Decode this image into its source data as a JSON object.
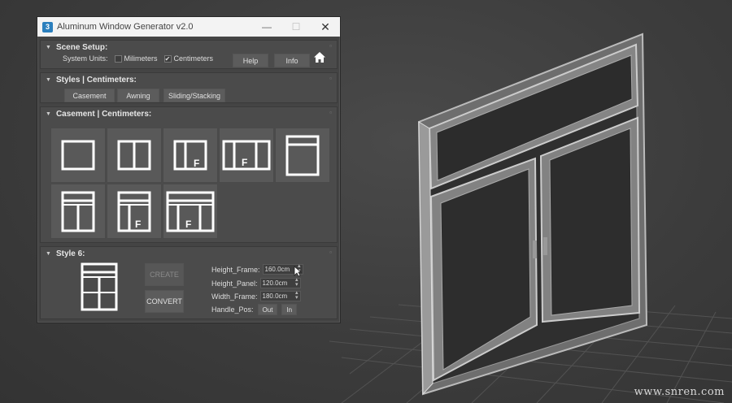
{
  "window": {
    "app_icon": "3",
    "title": "Aluminum Window Generator v2.0",
    "minimize_icon": "minimize-icon",
    "maximize_icon": "maximize-icon",
    "close_icon": "close-icon"
  },
  "scene_setup": {
    "heading": "Scene Setup:",
    "system_units_label": "System Units:",
    "millimeters_label": "Milimeters",
    "millimeters_checked": false,
    "centimeters_label": "Centimeters",
    "centimeters_checked": true,
    "help_label": "Help",
    "info_label": "Info",
    "home_icon": "home-icon"
  },
  "styles": {
    "heading": "Styles | Centimeters:",
    "buttons": [
      "Casement",
      "Awning",
      "Sliding/Stacking"
    ]
  },
  "casement": {
    "heading": "Casement | Centimeters:",
    "thumbnails": [
      {
        "name": "style-1",
        "glyph": ""
      },
      {
        "name": "style-2",
        "glyph": ""
      },
      {
        "name": "style-3",
        "glyph": "F"
      },
      {
        "name": "style-4",
        "glyph": "F"
      },
      {
        "name": "style-5",
        "glyph": ""
      },
      {
        "name": "style-6",
        "glyph": ""
      },
      {
        "name": "style-7",
        "glyph": "F"
      },
      {
        "name": "style-8",
        "glyph": "F"
      }
    ]
  },
  "style6": {
    "heading": "Style 6:",
    "create_label": "CREATE",
    "convert_label": "CONVERT",
    "height_frame_label": "Height_Frame:",
    "height_frame_value": "160.0cm",
    "height_panel_label": "Height_Panel:",
    "height_panel_value": "120.0cm",
    "width_frame_label": "Width_Frame:",
    "width_frame_value": "180.0cm",
    "handle_pos_label": "Handle_Pos:",
    "handle_out_label": "Out",
    "handle_in_label": "In"
  },
  "watermark": "www.snren.com",
  "colors": {
    "panel": "#4b4b4b",
    "button": "#5c5c5c",
    "icon_white": "#ffffff",
    "titlebar": "#f3f3f3"
  }
}
